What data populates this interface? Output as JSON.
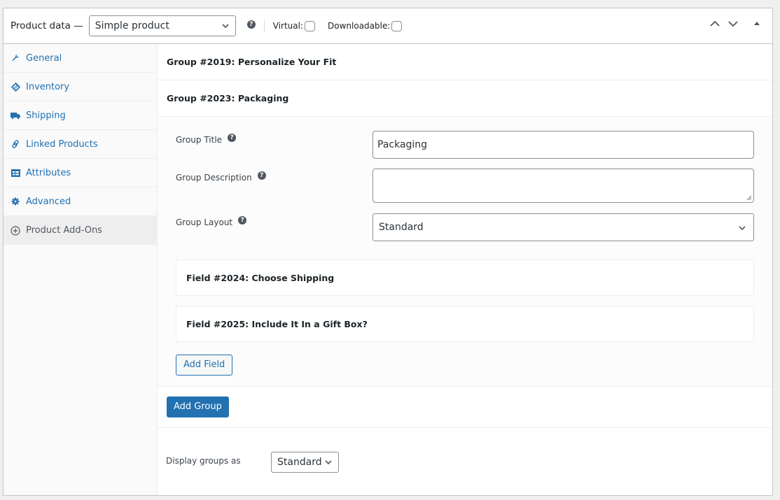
{
  "header": {
    "title": "Product data —",
    "product_type": "Simple product",
    "virtual_label": "Virtual:",
    "virtual_checked": false,
    "downloadable_label": "Downloadable:",
    "downloadable_checked": false
  },
  "sidebar": {
    "items": [
      {
        "label": "General",
        "icon": "wrench-icon"
      },
      {
        "label": "Inventory",
        "icon": "tag-icon"
      },
      {
        "label": "Shipping",
        "icon": "truck-icon"
      },
      {
        "label": "Linked Products",
        "icon": "link-icon"
      },
      {
        "label": "Attributes",
        "icon": "list-card-icon"
      },
      {
        "label": "Advanced",
        "icon": "gear-icon"
      },
      {
        "label": "Product Add-Ons",
        "icon": "plus-circle-icon",
        "active": true
      }
    ]
  },
  "groups": [
    {
      "title": "Group #2019: Personalize Your Fit"
    },
    {
      "title": "Group #2023: Packaging"
    }
  ],
  "group_form": {
    "title_label": "Group Title",
    "title_value": "Packaging",
    "description_label": "Group Description",
    "description_value": "",
    "layout_label": "Group Layout",
    "layout_value": "Standard"
  },
  "fields": [
    {
      "title": "Field #2024: Choose Shipping"
    },
    {
      "title": "Field #2025: Include It In a Gift Box?"
    }
  ],
  "buttons": {
    "add_field": "Add Field",
    "add_group": "Add Group"
  },
  "display": {
    "label": "Display groups as",
    "value": "Standard"
  },
  "colors": {
    "accent": "#2271b1",
    "active_tab_bg": "#eeeeee"
  }
}
